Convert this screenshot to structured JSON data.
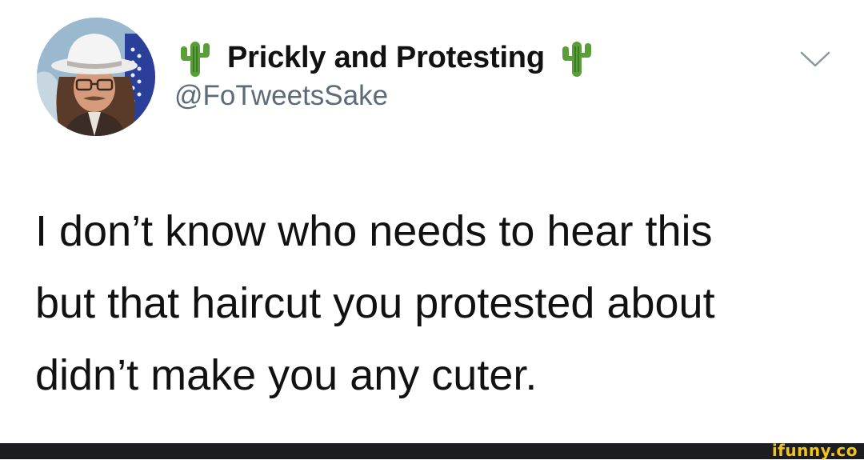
{
  "tweet": {
    "display_name": "Prickly and Protesting",
    "name_emoji_left": "cactus-icon",
    "name_emoji_right": "cactus-icon",
    "handle": "@FoTweetsSake",
    "text_lines": [
      "I don’t know who needs to hear this",
      "but that haircut you protested about",
      "didn’t make you any cuter."
    ],
    "menu_icon": "chevron-down-icon"
  },
  "footer": {
    "watermark": "ifunny.co",
    "watermark_color": "#f6c214",
    "background_color": "#1c1d21"
  },
  "colors": {
    "text": "#111111",
    "handle": "#5b6b78",
    "background": "#ffffff"
  }
}
